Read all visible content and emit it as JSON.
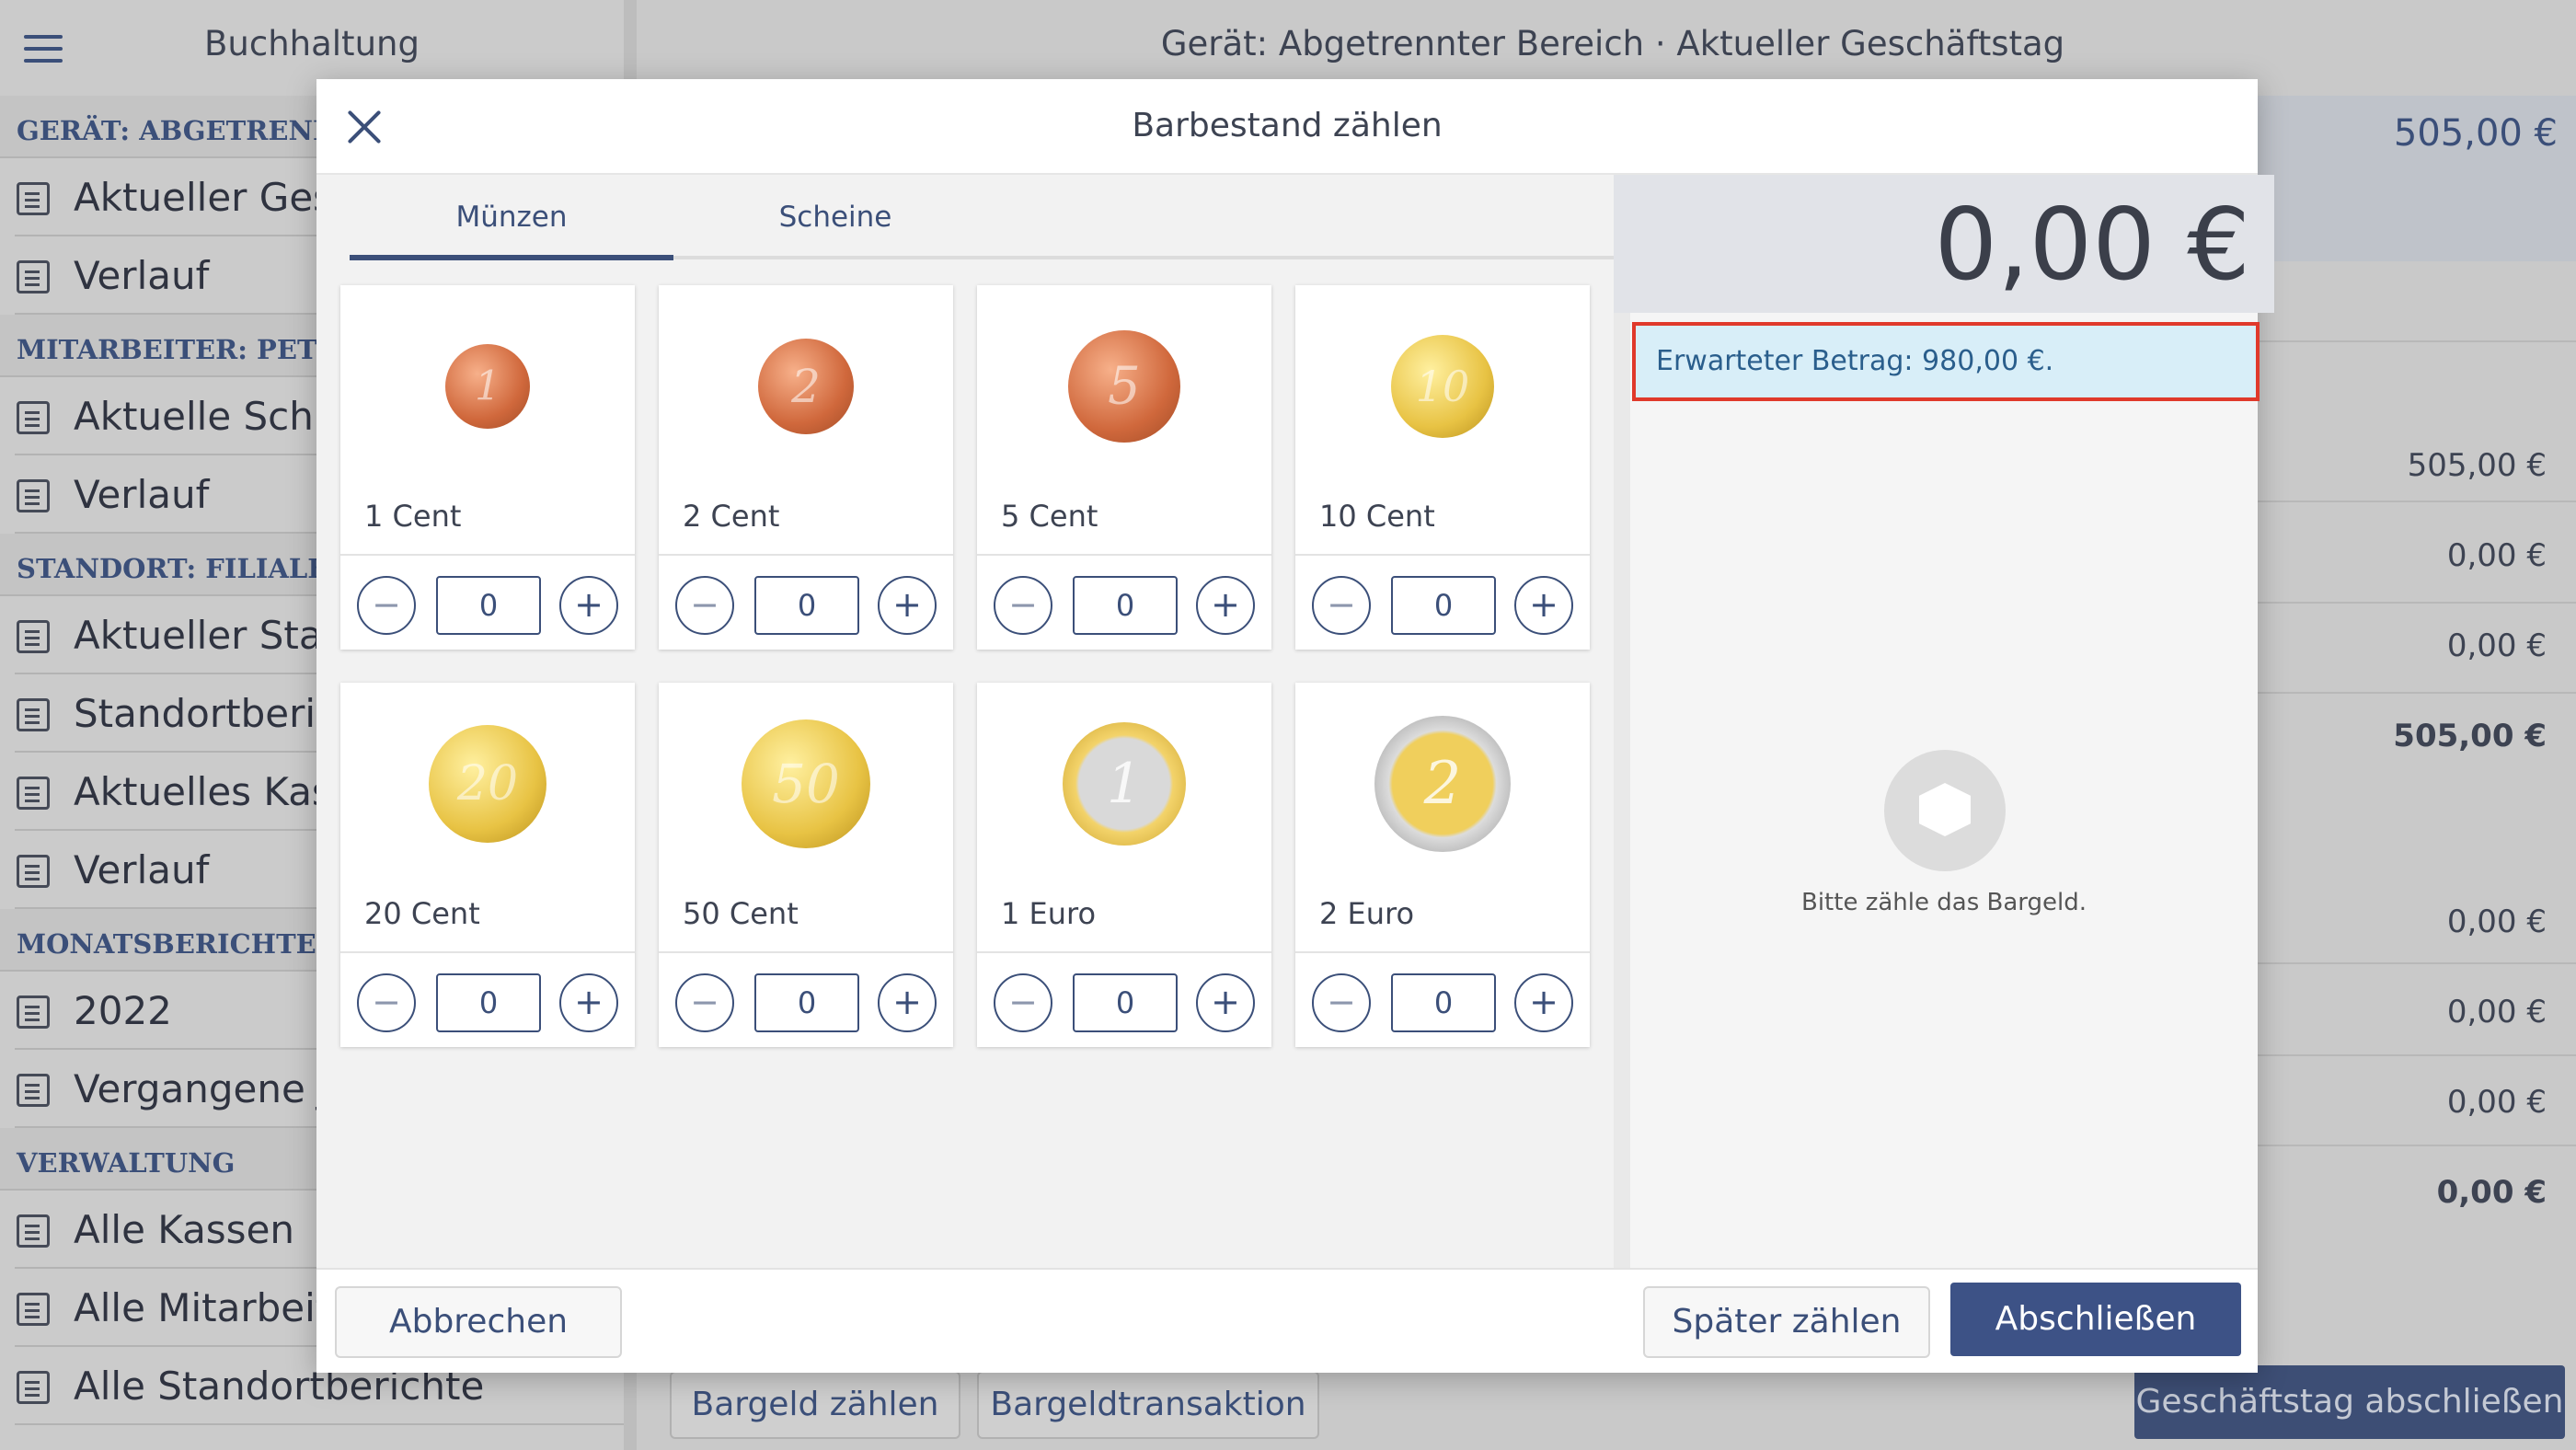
{
  "sidebar": {
    "title": "Buchhaltung",
    "sections": [
      {
        "heading": "GERÄT: ABGETRENNTER",
        "items": [
          "Aktueller Gesch",
          "Verlauf"
        ]
      },
      {
        "heading": "MITARBEITER: PETER H",
        "items": [
          "Aktuelle Schich",
          "Verlauf"
        ]
      },
      {
        "heading": "STANDORT: FILIALE AM",
        "items": [
          "Aktueller Stanc",
          "Standortberich",
          "Aktuelles Kasse",
          "Verlauf"
        ]
      },
      {
        "heading": "MONATSBERICHTE",
        "items": [
          "2022",
          "Vergangene Jal"
        ]
      },
      {
        "heading": "VERWALTUNG",
        "items": [
          "Alle Kassen",
          "Alle Mitarbeite",
          "Alle Standortberichte"
        ]
      }
    ]
  },
  "main": {
    "title": "Gerät: Abgetrennter Bereich · Aktueller Geschäftstag",
    "top_amount": "505,00 €",
    "rows": [
      "505,00 €",
      "0,00 €",
      "0,00 €",
      "505,00 €",
      "0,00 €",
      "0,00 €",
      "0,00 €",
      "0,00 €"
    ],
    "buttons": {
      "count_cash": "Bargeld zählen",
      "cash_transaction": "Bargeldtransaktion",
      "close_day": "Geschäftstag abschließen"
    }
  },
  "modal": {
    "title": "Barbestand zählen",
    "tabs": [
      "Münzen",
      "Scheine"
    ],
    "coins": [
      {
        "label": "1 Cent",
        "mark": "1",
        "qty": "0"
      },
      {
        "label": "2 Cent",
        "mark": "2",
        "qty": "0"
      },
      {
        "label": "5 Cent",
        "mark": "5",
        "qty": "0"
      },
      {
        "label": "10 Cent",
        "mark": "10",
        "qty": "0"
      },
      {
        "label": "20 Cent",
        "mark": "20",
        "qty": "0"
      },
      {
        "label": "50 Cent",
        "mark": "50",
        "qty": "0"
      },
      {
        "label": "1 Euro",
        "mark": "1",
        "qty": "0"
      },
      {
        "label": "2 Euro",
        "mark": "2",
        "qty": "0"
      }
    ],
    "stepper": {
      "minus": "−",
      "plus": "+"
    },
    "total": "0,00 €",
    "expected": "Erwarteter Betrag: 980,00 €.",
    "empty_text": "Bitte zähle das Bargeld.",
    "buttons": {
      "cancel": "Abbrechen",
      "later": "Später zählen",
      "finish": "Abschließen"
    }
  }
}
